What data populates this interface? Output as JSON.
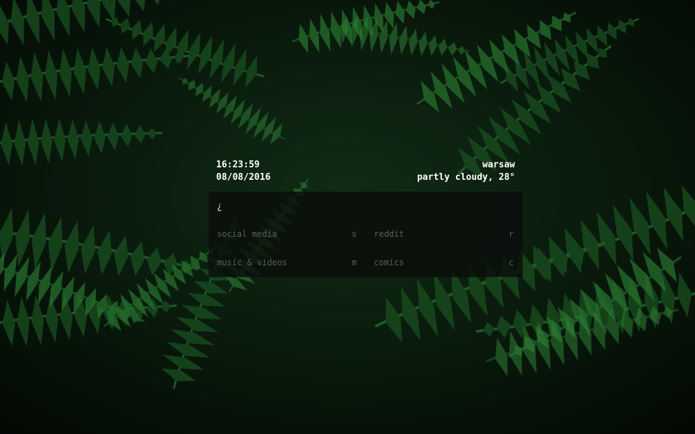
{
  "clock": {
    "time": "16:23:59",
    "date": "08/08/2016"
  },
  "weather": {
    "city": "warsaw",
    "condition": "partly cloudy, 28°"
  },
  "search": {
    "prompt_symbol": "¿"
  },
  "links": [
    {
      "name": "social media",
      "key": "s"
    },
    {
      "name": "reddit",
      "key": "r"
    },
    {
      "name": "music & videos",
      "key": "m"
    },
    {
      "name": "comics",
      "key": "c"
    }
  ],
  "colors": {
    "text_primary": "#ffffff",
    "text_muted": "#5c5e5c",
    "panel_bg": "rgba(10,12,10,0.80)",
    "foliage": "#1f5a26"
  }
}
